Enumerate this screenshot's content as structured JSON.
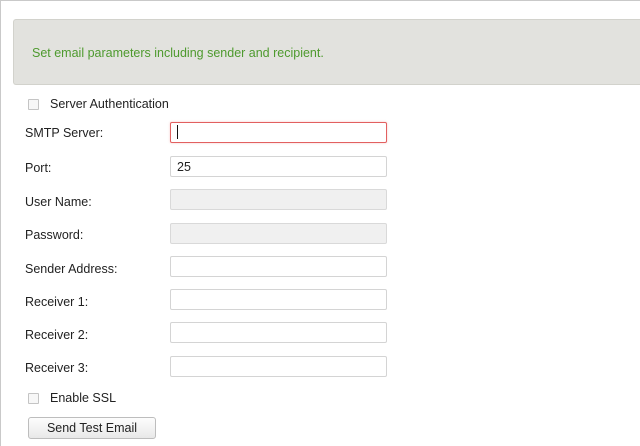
{
  "info": {
    "text": "Set email parameters including sender and recipient."
  },
  "server_auth": {
    "label": "Server Authentication",
    "checked": false
  },
  "fields": {
    "smtp_server": {
      "label": "SMTP Server:",
      "value": ""
    },
    "port": {
      "label": "Port:",
      "value": "25"
    },
    "user_name": {
      "label": "User Name:",
      "value": "",
      "disabled": true
    },
    "password": {
      "label": "Password:",
      "value": "",
      "disabled": true
    },
    "sender_address": {
      "label": "Sender Address:",
      "value": ""
    },
    "receiver1": {
      "label": "Receiver 1:",
      "value": ""
    },
    "receiver2": {
      "label": "Receiver 2:",
      "value": ""
    },
    "receiver3": {
      "label": "Receiver 3:",
      "value": ""
    }
  },
  "enable_ssl": {
    "label": "Enable SSL",
    "checked": false
  },
  "buttons": {
    "send_test_email": "Send Test Email"
  },
  "colors": {
    "info_text": "#4e9a2e",
    "focus_border": "#e26060"
  }
}
